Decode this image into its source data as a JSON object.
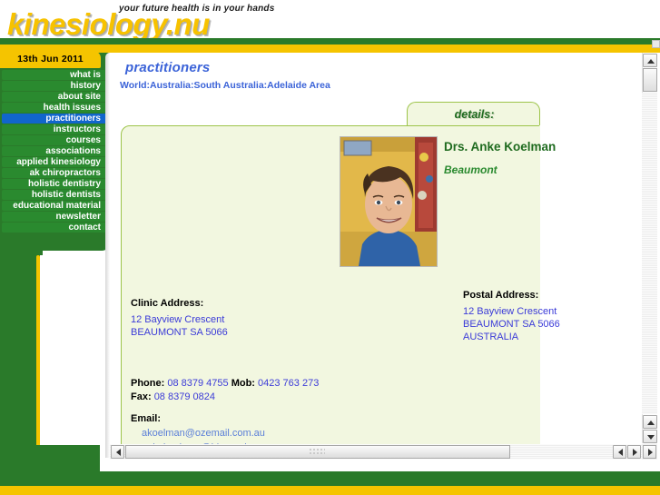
{
  "header": {
    "logo": "kinesiology.nu",
    "tagline": "your future health is in your hands"
  },
  "sidebar": {
    "date_badge": "13th Jun 2011",
    "items": [
      {
        "label": "what is",
        "active": false
      },
      {
        "label": "history",
        "active": false
      },
      {
        "label": "about site",
        "active": false
      },
      {
        "label": "health issues",
        "active": false
      },
      {
        "label": "practitioners",
        "active": true
      },
      {
        "label": "instructors",
        "active": false
      },
      {
        "label": "courses",
        "active": false
      },
      {
        "label": "associations",
        "active": false
      },
      {
        "label": "applied kinesiology",
        "active": false
      },
      {
        "label": "ak chiropractors",
        "active": false
      },
      {
        "label": "holistic dentistry",
        "active": false
      },
      {
        "label": "holistic dentists",
        "active": false
      },
      {
        "label": "educational material",
        "active": false
      },
      {
        "label": "newsletter",
        "active": false
      },
      {
        "label": "contact",
        "active": false
      }
    ]
  },
  "main": {
    "page_title": "practitioners",
    "breadcrumb": "World:Australia:South Australia:Adelaide Area",
    "tab_label": "details:",
    "practitioner": {
      "name": "Drs. Anke Koelman",
      "suburb": "Beaumont",
      "photo_alt": "portrait-photo"
    },
    "clinic_address": {
      "heading": "Clinic Address:",
      "lines": [
        "12 Bayview Crescent",
        "BEAUMONT SA 5066"
      ]
    },
    "postal_address": {
      "heading": "Postal Address:",
      "lines": [
        "12 Bayview Crescent",
        "BEAUMONT SA 5066",
        "AUSTRALIA"
      ]
    },
    "contact": {
      "phone_label": "Phone:",
      "phone_value": "08 8379 4755",
      "mob_label": "Mob:",
      "mob_value": "0423 763 273",
      "fax_label": "Fax:",
      "fax_value": "08 8379 0824",
      "email_label": "Email:",
      "email_1": "akoelman@ozemail.com.au",
      "email_2": "ankekoelman@bigpond.com"
    }
  },
  "colors": {
    "brand_green": "#2a7a2a",
    "brand_yellow": "#f5c400",
    "link_blue": "#3b3bd8",
    "active_nav": "#1166cc",
    "card_bg": "#f2f7e0",
    "card_border": "#9dc44a"
  }
}
